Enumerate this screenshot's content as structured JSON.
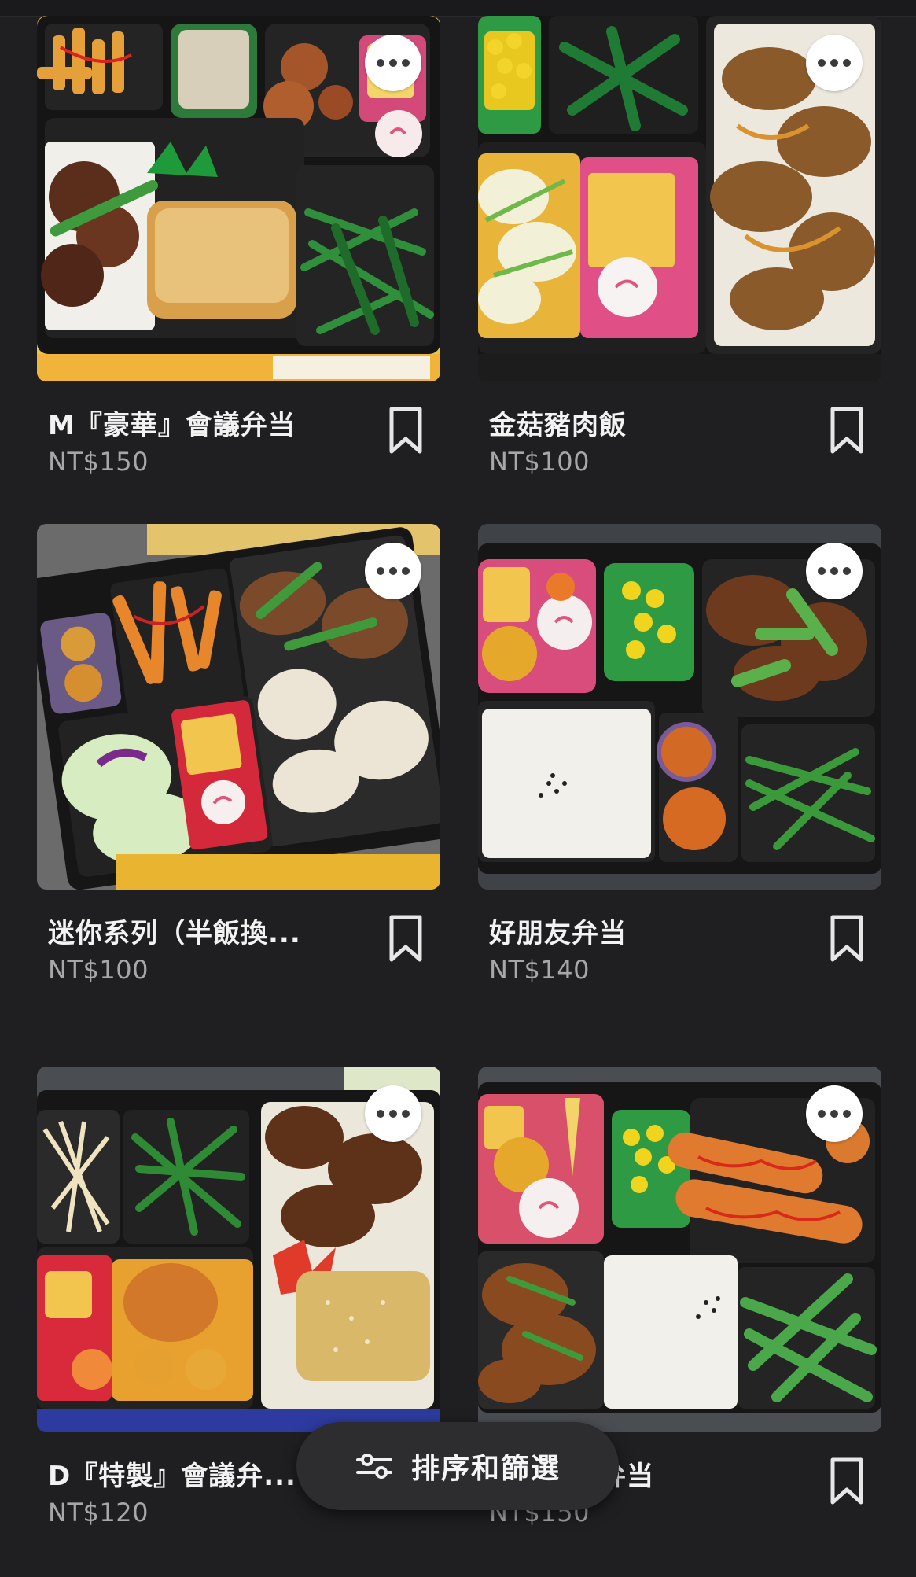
{
  "products": [
    {
      "title": "M『豪華』會議弁当",
      "price": "NT$150",
      "more_icon": "more-horizontal-icon",
      "save_icon": "bookmark-icon"
    },
    {
      "title": "金菇豬肉飯",
      "price": "NT$100",
      "more_icon": "more-horizontal-icon",
      "save_icon": "bookmark-icon"
    },
    {
      "title": "迷你系列（半飯換...",
      "price": "NT$100",
      "more_icon": "more-horizontal-icon",
      "save_icon": "bookmark-icon"
    },
    {
      "title": "好朋友弁当",
      "price": "NT$140",
      "more_icon": "more-horizontal-icon",
      "save_icon": "bookmark-icon"
    },
    {
      "title": "D『特製』會議弁...",
      "price": "NT$120",
      "more_icon": "more-horizontal-icon",
      "save_icon": "bookmark-icon"
    },
    {
      "title": "酒揚海老弁当",
      "price": "NT$150",
      "more_icon": "more-horizontal-icon",
      "save_icon": "bookmark-icon"
    }
  ],
  "sort_filter": {
    "label": "排序和篩選",
    "icon": "sliders-icon"
  },
  "colors": {
    "background": "#1f1f21",
    "pill": "#2d2d30",
    "price_text": "#a7a7ab"
  }
}
